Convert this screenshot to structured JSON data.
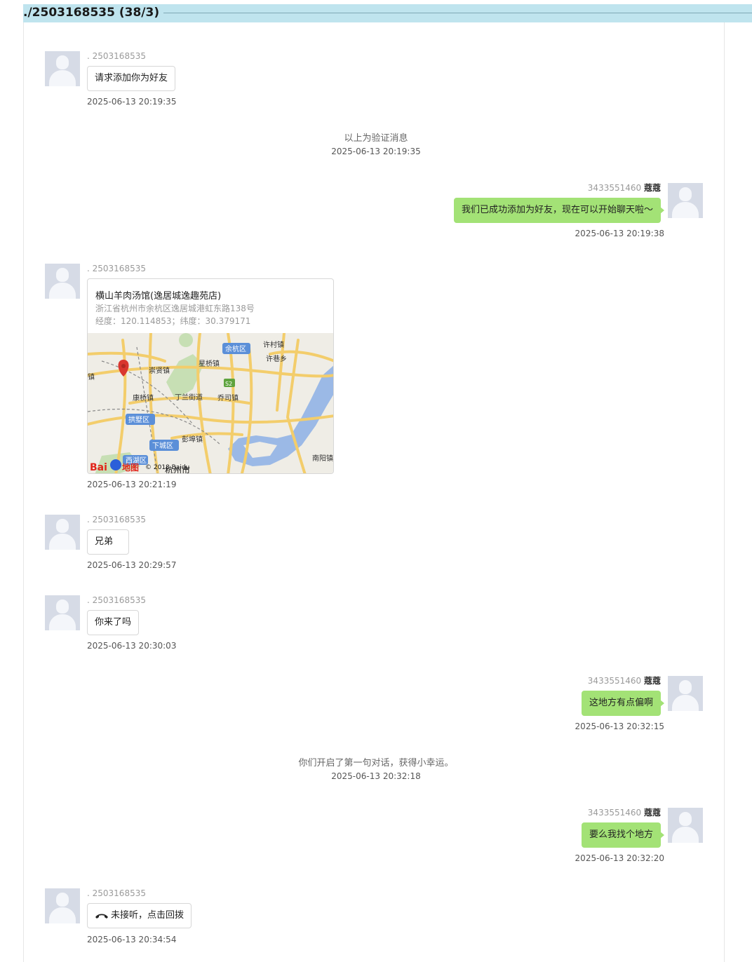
{
  "header": {
    "title": "./2503168535 (38/3)"
  },
  "colors": {
    "header_bg": "#bfe4ee",
    "outgoing_bubble": "#a3e276",
    "incoming_border": "#d7d7d7"
  },
  "messages": [
    {
      "sender": ". 2503168535",
      "text": "请求添加你为好友",
      "time": "2025-06-13 20:19:35"
    },
    {
      "system_text": "以上为验证消息",
      "time": "2025-06-13 20:19:35"
    },
    {
      "sender_id": "3433551460",
      "sender_nick": "蔻蔻",
      "text": "我们已成功添加为好友，现在可以开始聊天啦～",
      "time": "2025-06-13 20:19:38"
    },
    {
      "sender": ". 2503168535",
      "location": {
        "name": "横山羊肉汤馆(逸居城逸趣苑店)",
        "address": "浙江省杭州市余杭区逸居城港虹东路138号",
        "coords": "经度：120.114853；纬度：30.379171",
        "map_labels": {
          "yuhang": "余杭区",
          "xucun": "许村镇",
          "xuxiang": "许巷乡",
          "chongxian": "崇贤镇",
          "xingqiao": "星桥镇",
          "s2": "S2",
          "kangqiao": "康桥镇",
          "dinglan": "丁兰街道",
          "qiaosi": "乔司镇",
          "gongshu": "拱墅区",
          "xiacheng": "下城区",
          "pengbu": "彭埠镇",
          "xihu": "西湖区",
          "nanyang": "南阳镇",
          "hangzhou": "杭州市",
          "left_cut": "镇",
          "copyright": "© 2018 Baidu",
          "baidu_logo": "Bai",
          "baidu_map": "地图"
        }
      },
      "time": "2025-06-13 20:21:19"
    },
    {
      "sender": ". 2503168535",
      "text": "兄弟",
      "time": "2025-06-13 20:29:57"
    },
    {
      "sender": ". 2503168535",
      "text": "你来了吗",
      "time": "2025-06-13 20:30:03"
    },
    {
      "sender_id": "3433551460",
      "sender_nick": "蔻蔻",
      "text": "这地方有点偏啊",
      "time": "2025-06-13 20:32:15"
    },
    {
      "system_text": "你们开启了第一句对话，获得小幸运。",
      "time": "2025-06-13 20:32:18"
    },
    {
      "sender_id": "3433551460",
      "sender_nick": "蔻蔻",
      "text": "要么我找个地方",
      "time": "2025-06-13 20:32:20"
    },
    {
      "sender": ". 2503168535",
      "text": "未接听，点击回拨",
      "icon": "phone-hangup-icon",
      "time": "2025-06-13 20:34:54"
    }
  ]
}
